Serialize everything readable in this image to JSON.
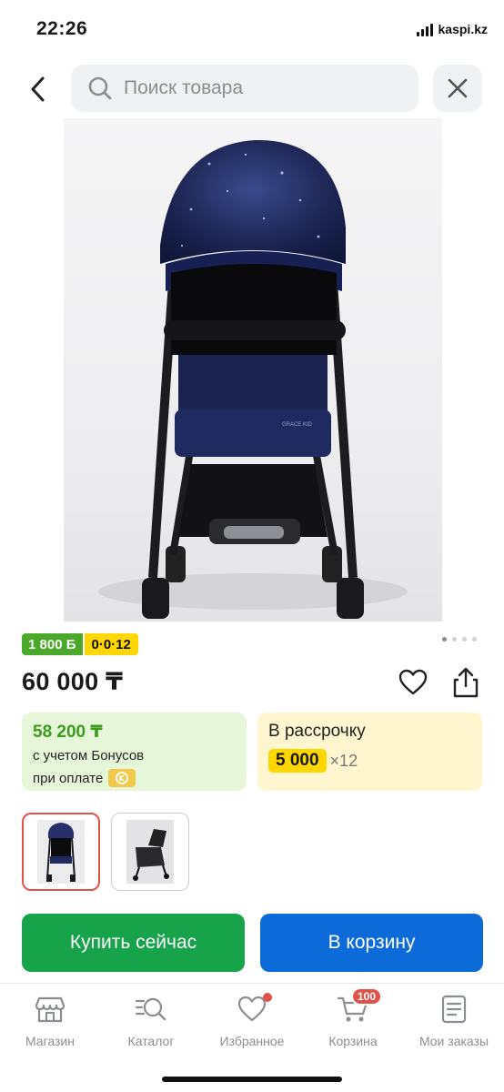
{
  "status_bar": {
    "time": "22:26",
    "site": "kaspi.kz"
  },
  "search": {
    "placeholder": "Поиск товара",
    "value": ""
  },
  "product": {
    "image_alt": "GRACE KID",
    "bonus_badge": "1 800 Б",
    "installment_badge": "0·0·12",
    "price": "60 000 ₸",
    "gallery_page": 1,
    "gallery_total": 4
  },
  "offers": {
    "bonus_price": "58 200 ₸",
    "bonus_line1": "с учетом Бонусов",
    "bonus_line2": "при оплате",
    "installment_title": "В рассрочку",
    "installment_monthly": "5 000",
    "installment_months": "×12"
  },
  "actions": {
    "buy_now": "Купить сейчас",
    "add_to_cart": "В корзину"
  },
  "nav": {
    "items": [
      {
        "label": "Магазин",
        "icon": "store-icon"
      },
      {
        "label": "Каталог",
        "icon": "catalog-search-icon"
      },
      {
        "label": "Избранное",
        "icon": "heart-icon"
      },
      {
        "label": "Корзина",
        "icon": "cart-icon",
        "badge": "100"
      },
      {
        "label": "Мои заказы",
        "icon": "orders-icon"
      }
    ]
  },
  "colors": {
    "buy_green": "#16a34a",
    "cart_blue": "#0d6bd9",
    "bonus_green": "#4aa82a",
    "installment_yellow": "#ffd700",
    "accent_red": "#e0534a"
  }
}
